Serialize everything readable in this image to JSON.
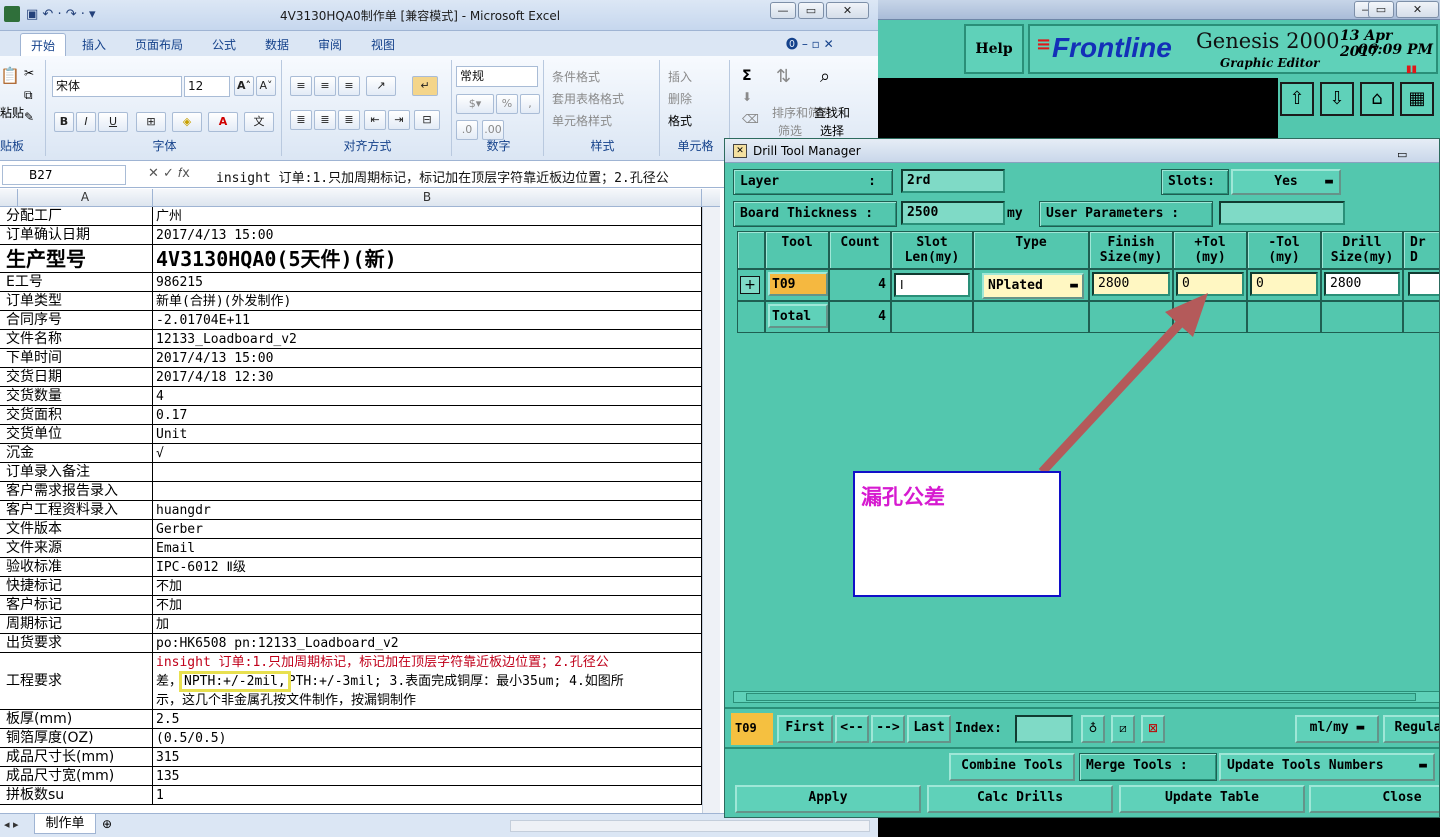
{
  "excel": {
    "title": "4V3130HQA0制作单  [兼容模式] - Microsoft Excel",
    "tabs": [
      "开始",
      "插入",
      "页面布局",
      "公式",
      "数据",
      "审阅",
      "视图"
    ],
    "clipboard": {
      "paste": "粘贴",
      "group": "贴板"
    },
    "font": {
      "name": "宋体",
      "size": "12",
      "group": "字体"
    },
    "alignment_group": "对齐方式",
    "number": {
      "format": "常规",
      "group": "数字"
    },
    "styles": {
      "conditional": "条件格式",
      "table": "套用表格格式",
      "cell": "单元格样式",
      "group": "样式"
    },
    "cells": {
      "insert": "插入",
      "delete": "删除",
      "format": "格式",
      "group": "单元格"
    },
    "editing": {
      "sort": "排序和筛选",
      "sort2": "筛选",
      "find": "查找和",
      "find2": "选择"
    },
    "namebox": "B27",
    "formula": "insight 订单:1.只加周期标记，标记加在顶层字符靠近板边位置；2.孔径公",
    "columns": [
      "A",
      "B"
    ],
    "sheet_tab": "制作单",
    "rows": [
      {
        "a": "分配工厂",
        "b": "广州"
      },
      {
        "a": "订单确认日期",
        "b": "2017/4/13 15:00"
      },
      {
        "a": "生产型号",
        "b": "4V3130HQA0(5天件)(新)"
      },
      {
        "a": "E工号",
        "b": "986215"
      },
      {
        "a": "订单类型",
        "b": "新单(合拼)(外发制作)"
      },
      {
        "a": "合同序号",
        "b": "-2.01704E+11"
      },
      {
        "a": "文件名称",
        "b": "12133_Loadboard_v2"
      },
      {
        "a": "下单时间",
        "b": "2017/4/13 15:00"
      },
      {
        "a": "交货日期",
        "b": "2017/4/18 12:30"
      },
      {
        "a": "交货数量",
        "b": "4"
      },
      {
        "a": "交货面积",
        "b": "0.17"
      },
      {
        "a": "交货单位",
        "b": "Unit"
      },
      {
        "a": "沉金",
        "b": "√"
      },
      {
        "a": "订单录入备注",
        "b": ""
      },
      {
        "a": "客户需求报告录入",
        "b": ""
      },
      {
        "a": "客户工程资料录入",
        "b": "huangdr"
      },
      {
        "a": "文件版本",
        "b": "Gerber"
      },
      {
        "a": "文件来源",
        "b": "Email"
      },
      {
        "a": "验收标准",
        "b": "IPC-6012 Ⅱ级"
      },
      {
        "a": "快捷标记",
        "b": "不加"
      },
      {
        "a": "客户标记",
        "b": "不加"
      },
      {
        "a": "周期标记",
        "b": "加"
      },
      {
        "a": "出货要求",
        "b": "po:HK6508 pn:12133_Loadboard_v2"
      },
      {
        "a": "工程要求",
        "b1": "insight 订单:1.只加周期标记，标记加在顶层字符靠近板边位置；2.孔径公",
        "b2a": "差，",
        "b2h": "NPTH:+/-2mil,",
        "b2b": "PTH:+/-3mil; 3.表面完成铜厚：最小35um; 4.如图所",
        "b3": "示，这几个非金属孔按文件制作，按漏铜制作"
      },
      {
        "a": "板厚(mm)",
        "b": "2.5"
      },
      {
        "a": "铜箔厚度(OZ)",
        "b": "(0.5/0.5)"
      },
      {
        "a": "成品尺寸长(mm)",
        "b": "315"
      },
      {
        "a": "成品尺寸宽(mm)",
        "b": "135"
      },
      {
        "a": "拼板数su",
        "b": "1"
      }
    ]
  },
  "genesis": {
    "help": "Help",
    "logo": "Frontline",
    "product": "Genesis 2000",
    "subtitle": "Graphic Editor",
    "date": "13 Apr 2017",
    "time": "06:09 PM"
  },
  "dialog": {
    "title": "Drill Tool Manager",
    "layer_label": "Layer",
    "layer_sep": ":",
    "layer_value": "2rd",
    "slots_label": "Slots:",
    "slots_value": "Yes",
    "thickness_label": "Board Thickness :",
    "thickness_value": "2500",
    "thickness_unit": "my",
    "user_params_label": "User Parameters :",
    "headers": [
      {
        "l1": "Tool",
        "l2": ""
      },
      {
        "l1": "Count",
        "l2": ""
      },
      {
        "l1": "Slot",
        "l2": "Len(my)"
      },
      {
        "l1": "Type",
        "l2": ""
      },
      {
        "l1": "Finish",
        "l2": "Size(my)"
      },
      {
        "l1": "+Tol",
        "l2": "(my)"
      },
      {
        "l1": "-Tol",
        "l2": "(my)"
      },
      {
        "l1": "Drill",
        "l2": "Size(my)"
      },
      {
        "l1": "Dr",
        "l2": "D"
      }
    ],
    "row": {
      "tool": "T09",
      "count": "4",
      "type": "NPlated",
      "finish": "2800",
      "ptol": "0",
      "mtol": "0",
      "drill": "2800"
    },
    "total": {
      "label": "Total",
      "count": "4"
    },
    "nav": {
      "current": "T09",
      "first": "First",
      "prev": "<--",
      "next": "-->",
      "last": "Last",
      "index": "Index:",
      "units": "ml/my",
      "regula": "Regula"
    },
    "combine": "Combine Tools",
    "merge": "Merge Tools :",
    "update_numbers": "Update Tools Numbers",
    "apply": "Apply",
    "calc": "Calc Drills",
    "update_table": "Update Table",
    "close": "Close"
  },
  "annotation": {
    "text": "漏孔公差",
    "color": "#d61ad0"
  }
}
